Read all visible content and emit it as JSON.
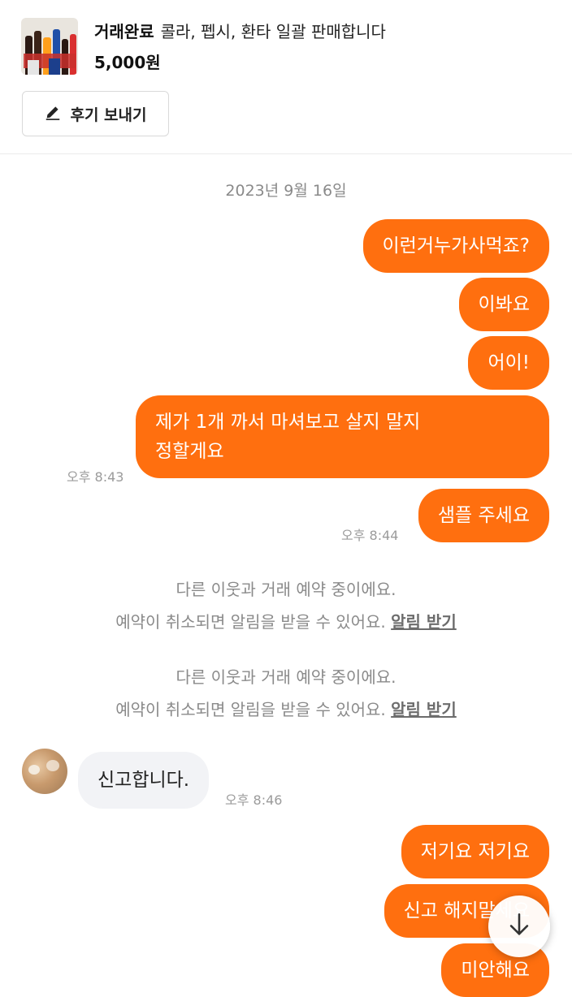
{
  "header": {
    "status": "거래완료",
    "title": "콜라, 펩시, 환타 일괄 판매합니다",
    "price": "5,000원",
    "review_button": "후기 보내기"
  },
  "chat": {
    "date": "2023년 9월 16일",
    "messages": [
      {
        "text": "이런거누가사먹죠?"
      },
      {
        "text": "이봐요"
      },
      {
        "text": "어이!"
      },
      {
        "line1": "제가 1개 까서 마셔보고 살지 말지",
        "line2": "정할게요",
        "time": "오후 8:43"
      },
      {
        "text": "샘플 주세요",
        "time": "오후 8:44"
      }
    ],
    "notices": [
      {
        "line1": "다른 이웃과 거래 예약 중이에요.",
        "line2": "예약이 취소되면 알림을 받을 수 있어요.",
        "link": "알림 받기"
      },
      {
        "line1": "다른 이웃과 거래 예약 중이에요.",
        "line2": "예약이 취소되면 알림을 받을 수 있어요.",
        "link": "알림 받기"
      }
    ],
    "incoming": {
      "text": "신고합니다.",
      "time": "오후 8:46"
    },
    "later": [
      {
        "text": "저기요 저기요"
      },
      {
        "text": "신고 해지말세요"
      },
      {
        "text": "미안해요"
      }
    ]
  },
  "colors": {
    "accent": "#ff6f0f",
    "incoming_bubble": "#f2f3f6"
  },
  "icons": {
    "review": "pencil-icon",
    "scroll": "arrow-down-icon"
  }
}
